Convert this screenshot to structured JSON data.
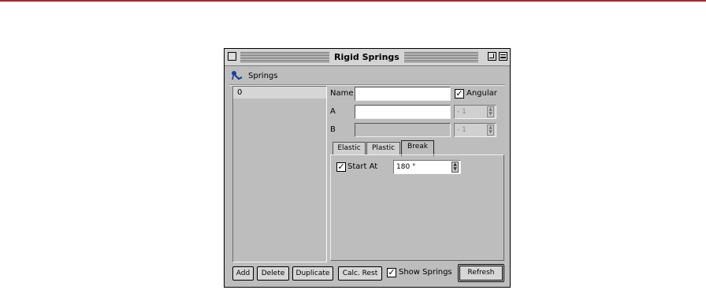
{
  "window": {
    "title": "Rigid Springs"
  },
  "header": {
    "label": "Springs",
    "icon": "springs-node-icon"
  },
  "list": {
    "items": [
      "0"
    ]
  },
  "fields": {
    "name_label": "Name",
    "name_value": "",
    "angular_label": "Angular",
    "angular_checked": true,
    "a_label": "A",
    "a_value": "",
    "a_index": "- 1",
    "b_label": "B",
    "b_value": "",
    "b_index": "- 1"
  },
  "tabs": [
    "Elastic",
    "Plastic",
    "Break"
  ],
  "active_tab": "Break",
  "break_tab": {
    "start_at_label": "Start At",
    "start_at_checked": true,
    "start_at_value": "180 °"
  },
  "buttons": {
    "add": "Add",
    "delete": "Delete",
    "duplicate": "Duplicate",
    "calc_rest": "Calc. Rest",
    "show_springs_label": "Show Springs",
    "show_springs_checked": true,
    "refresh": "Refresh"
  },
  "colors": {
    "accent_bar": "#a8262c",
    "window_bg": "#bdbdbd"
  }
}
